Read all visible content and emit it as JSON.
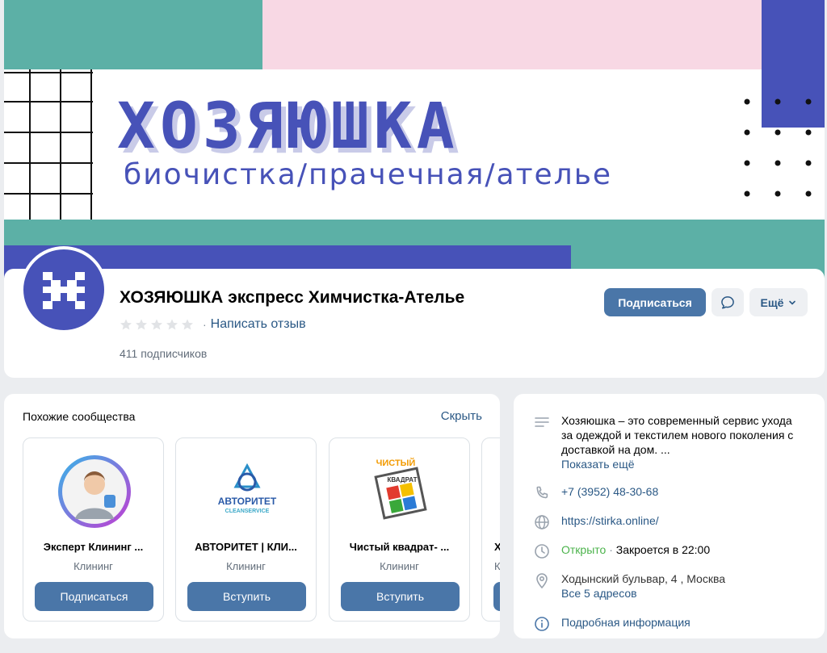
{
  "cover": {
    "logo_word": "ХОЗЯЮШКА",
    "tagline": "биочистка/прачечная/ателье"
  },
  "group": {
    "name": "ХОЗЯЮШКА экспресс Химчистка-Ателье",
    "rating_stars": 0,
    "write_review": "Написать отзыв",
    "subscribers": "411 подписчиков",
    "subscribe_label": "Подписаться",
    "more_label": "Ещё"
  },
  "similar": {
    "title": "Похожие сообщества",
    "hide_label": "Скрыть",
    "items": [
      {
        "name": "Эксперт Клининг ...",
        "category": "Клининг",
        "button": "Подписаться"
      },
      {
        "name": "АВТОРИТЕТ | КЛИ...",
        "category": "Клининг",
        "button": "Вступить",
        "logo_text": "АВТОРИТЕТ",
        "logo_sub": "CLEANSERVICE"
      },
      {
        "name": "Чистый квадрат- ...",
        "category": "Клининг",
        "button": "Вступить",
        "logo_text_top": "ЧИСТЫЙ",
        "logo_text_mid": "КВАДРАТ"
      },
      {
        "name": "Х",
        "category": "К",
        "button": ""
      }
    ]
  },
  "info": {
    "description": "Хозяюшка – это современный сервис ухода за одеждой и текстилем нового поколения с доставкой на дом. ...",
    "show_more": "Показать ещё",
    "phone": "+7 (3952) 48-30-68",
    "website": "https://stirka.online/",
    "open_status": "Открыто",
    "closes": "Закроется в 22:00",
    "address": "Ходынский бульвар, 4 , Москва",
    "all_addresses": "Все 5 адресов",
    "details": "Подробная информация"
  },
  "colors": {
    "brand_blue": "#4752b8",
    "teal": "#5cb0a6",
    "pink": "#f8d8e4",
    "button_blue": "#4a76a8",
    "link": "#2a5885"
  }
}
